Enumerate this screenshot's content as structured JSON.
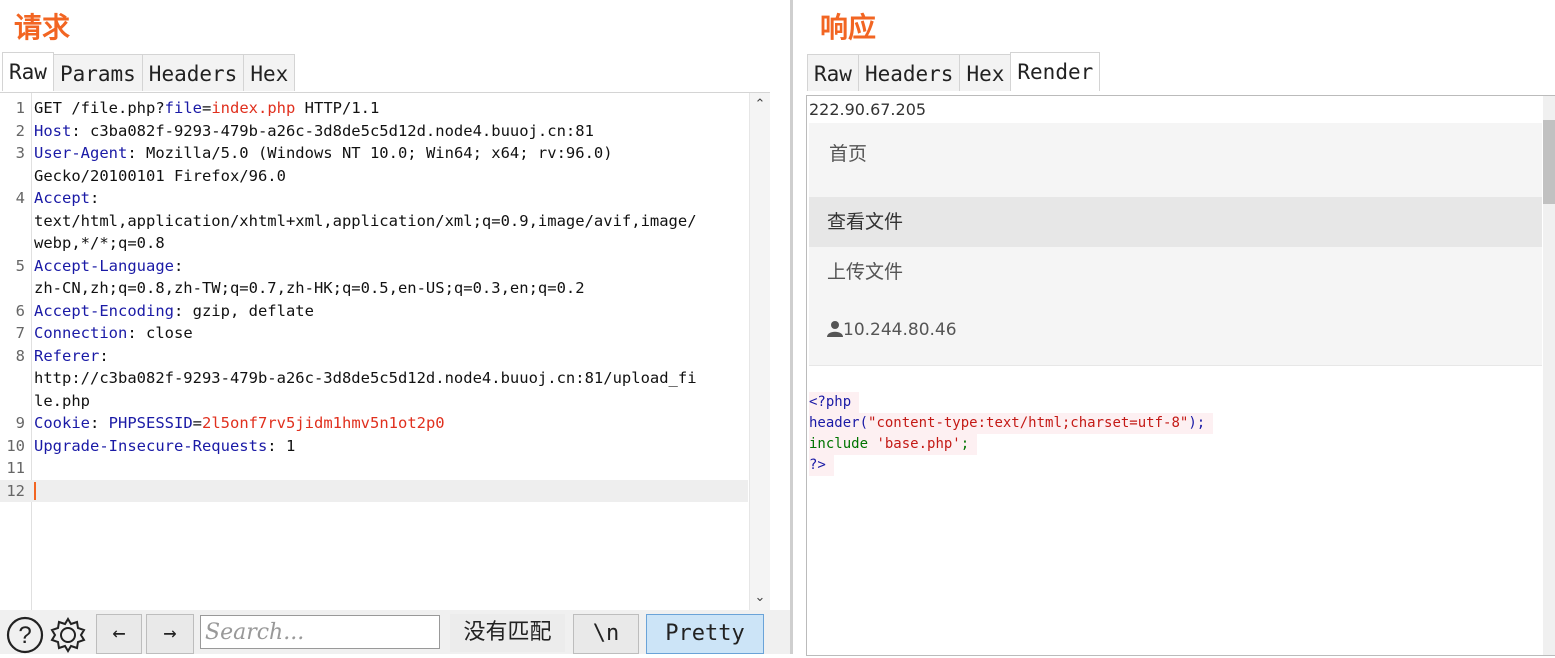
{
  "request": {
    "title": "请求",
    "tabs": [
      "Raw",
      "Params",
      "Headers",
      "Hex"
    ],
    "active_tab": "Raw",
    "lines": [
      {
        "n": "1",
        "parts": [
          {
            "t": "GET /file.php?",
            "c": ""
          },
          {
            "t": "file",
            "c": "key"
          },
          {
            "t": "=",
            "c": ""
          },
          {
            "t": "index.php",
            "c": "red"
          },
          {
            "t": " HTTP/1.1",
            "c": ""
          }
        ]
      },
      {
        "n": "2",
        "parts": [
          {
            "t": "Host",
            "c": "key"
          },
          {
            "t": ": c3ba082f-9293-479b-a26c-3d8de5c5d12d.node4.buuoj.cn:81",
            "c": ""
          }
        ]
      },
      {
        "n": "3",
        "parts": [
          {
            "t": "User-Agent",
            "c": "key"
          },
          {
            "t": ": Mozilla/5.0 (Windows NT 10.0; Win64; x64; rv:96.0)",
            "c": ""
          }
        ]
      },
      {
        "n": "",
        "parts": [
          {
            "t": "Gecko/20100101 Firefox/96.0",
            "c": ""
          }
        ]
      },
      {
        "n": "4",
        "parts": [
          {
            "t": "Accept",
            "c": "key"
          },
          {
            "t": ":",
            "c": ""
          }
        ]
      },
      {
        "n": "",
        "parts": [
          {
            "t": "text/html,application/xhtml+xml,application/xml;q=0.9,image/avif,image/",
            "c": ""
          }
        ]
      },
      {
        "n": "",
        "parts": [
          {
            "t": "webp,*/*;q=0.8",
            "c": ""
          }
        ]
      },
      {
        "n": "5",
        "parts": [
          {
            "t": "Accept-Language",
            "c": "key"
          },
          {
            "t": ":",
            "c": ""
          }
        ]
      },
      {
        "n": "",
        "parts": [
          {
            "t": "zh-CN,zh;q=0.8,zh-TW;q=0.7,zh-HK;q=0.5,en-US;q=0.3,en;q=0.2",
            "c": ""
          }
        ]
      },
      {
        "n": "6",
        "parts": [
          {
            "t": "Accept-Encoding",
            "c": "key"
          },
          {
            "t": ": gzip, deflate",
            "c": ""
          }
        ]
      },
      {
        "n": "7",
        "parts": [
          {
            "t": "Connection",
            "c": "key"
          },
          {
            "t": ": close",
            "c": ""
          }
        ]
      },
      {
        "n": "8",
        "parts": [
          {
            "t": "Referer",
            "c": "key"
          },
          {
            "t": ":",
            "c": ""
          }
        ]
      },
      {
        "n": "",
        "parts": [
          {
            "t": "http://c3ba082f-9293-479b-a26c-3d8de5c5d12d.node4.buuoj.cn:81/upload_fi",
            "c": ""
          }
        ]
      },
      {
        "n": "",
        "parts": [
          {
            "t": "le.php",
            "c": ""
          }
        ]
      },
      {
        "n": "9",
        "parts": [
          {
            "t": "Cookie",
            "c": "key"
          },
          {
            "t": ": ",
            "c": ""
          },
          {
            "t": "PHPSESSID",
            "c": "key"
          },
          {
            "t": "=",
            "c": ""
          },
          {
            "t": "2l5onf7rv5jidm1hmv5n1ot2p0",
            "c": "red"
          }
        ]
      },
      {
        "n": "10",
        "parts": [
          {
            "t": "Upgrade-Insecure-Requests",
            "c": "key"
          },
          {
            "t": ": 1",
            "c": ""
          }
        ]
      },
      {
        "n": "11",
        "parts": []
      },
      {
        "n": "12",
        "parts": [],
        "current": true
      }
    ]
  },
  "toolbar": {
    "help_icon": "question-circle-icon",
    "settings_icon": "gear-icon",
    "back_label": "←",
    "forward_label": "→",
    "search_placeholder": "Search...",
    "no_match": "没有匹配",
    "newline_label": "\\n",
    "pretty_label": "Pretty"
  },
  "response": {
    "title": "响应",
    "tabs": [
      "Raw",
      "Headers",
      "Hex",
      "Render"
    ],
    "active_tab": "Render",
    "render": {
      "top_ip": "222.90.67.205",
      "nav": [
        {
          "label": "首页",
          "active": false
        },
        {
          "label": "查看文件",
          "active": true
        },
        {
          "label": "上传文件",
          "active": false
        }
      ],
      "user_ip": "10.244.80.46",
      "user_icon": "user-icon",
      "php_lines": [
        [
          {
            "t": "<?php",
            "c": "#1a1aa6"
          }
        ],
        [
          {
            "t": "header(",
            "c": "#1a1aa6"
          },
          {
            "t": "\"content-type:text/html;charset=utf-8\"",
            "c": "#c41a16"
          },
          {
            "t": ");",
            "c": "#1a1aa6"
          }
        ],
        [
          {
            "t": "include ",
            "c": "#007400"
          },
          {
            "t": "'base.php'",
            "c": "#c41a16"
          },
          {
            "t": ";",
            "c": "#007400"
          }
        ],
        [
          {
            "t": "?>",
            "c": "#1a1aa6"
          }
        ]
      ]
    }
  },
  "colors": {
    "accent": "#f26522",
    "key": "#1a1aa6",
    "value_red": "#e0301e",
    "pretty_bg": "#cce4f7"
  }
}
